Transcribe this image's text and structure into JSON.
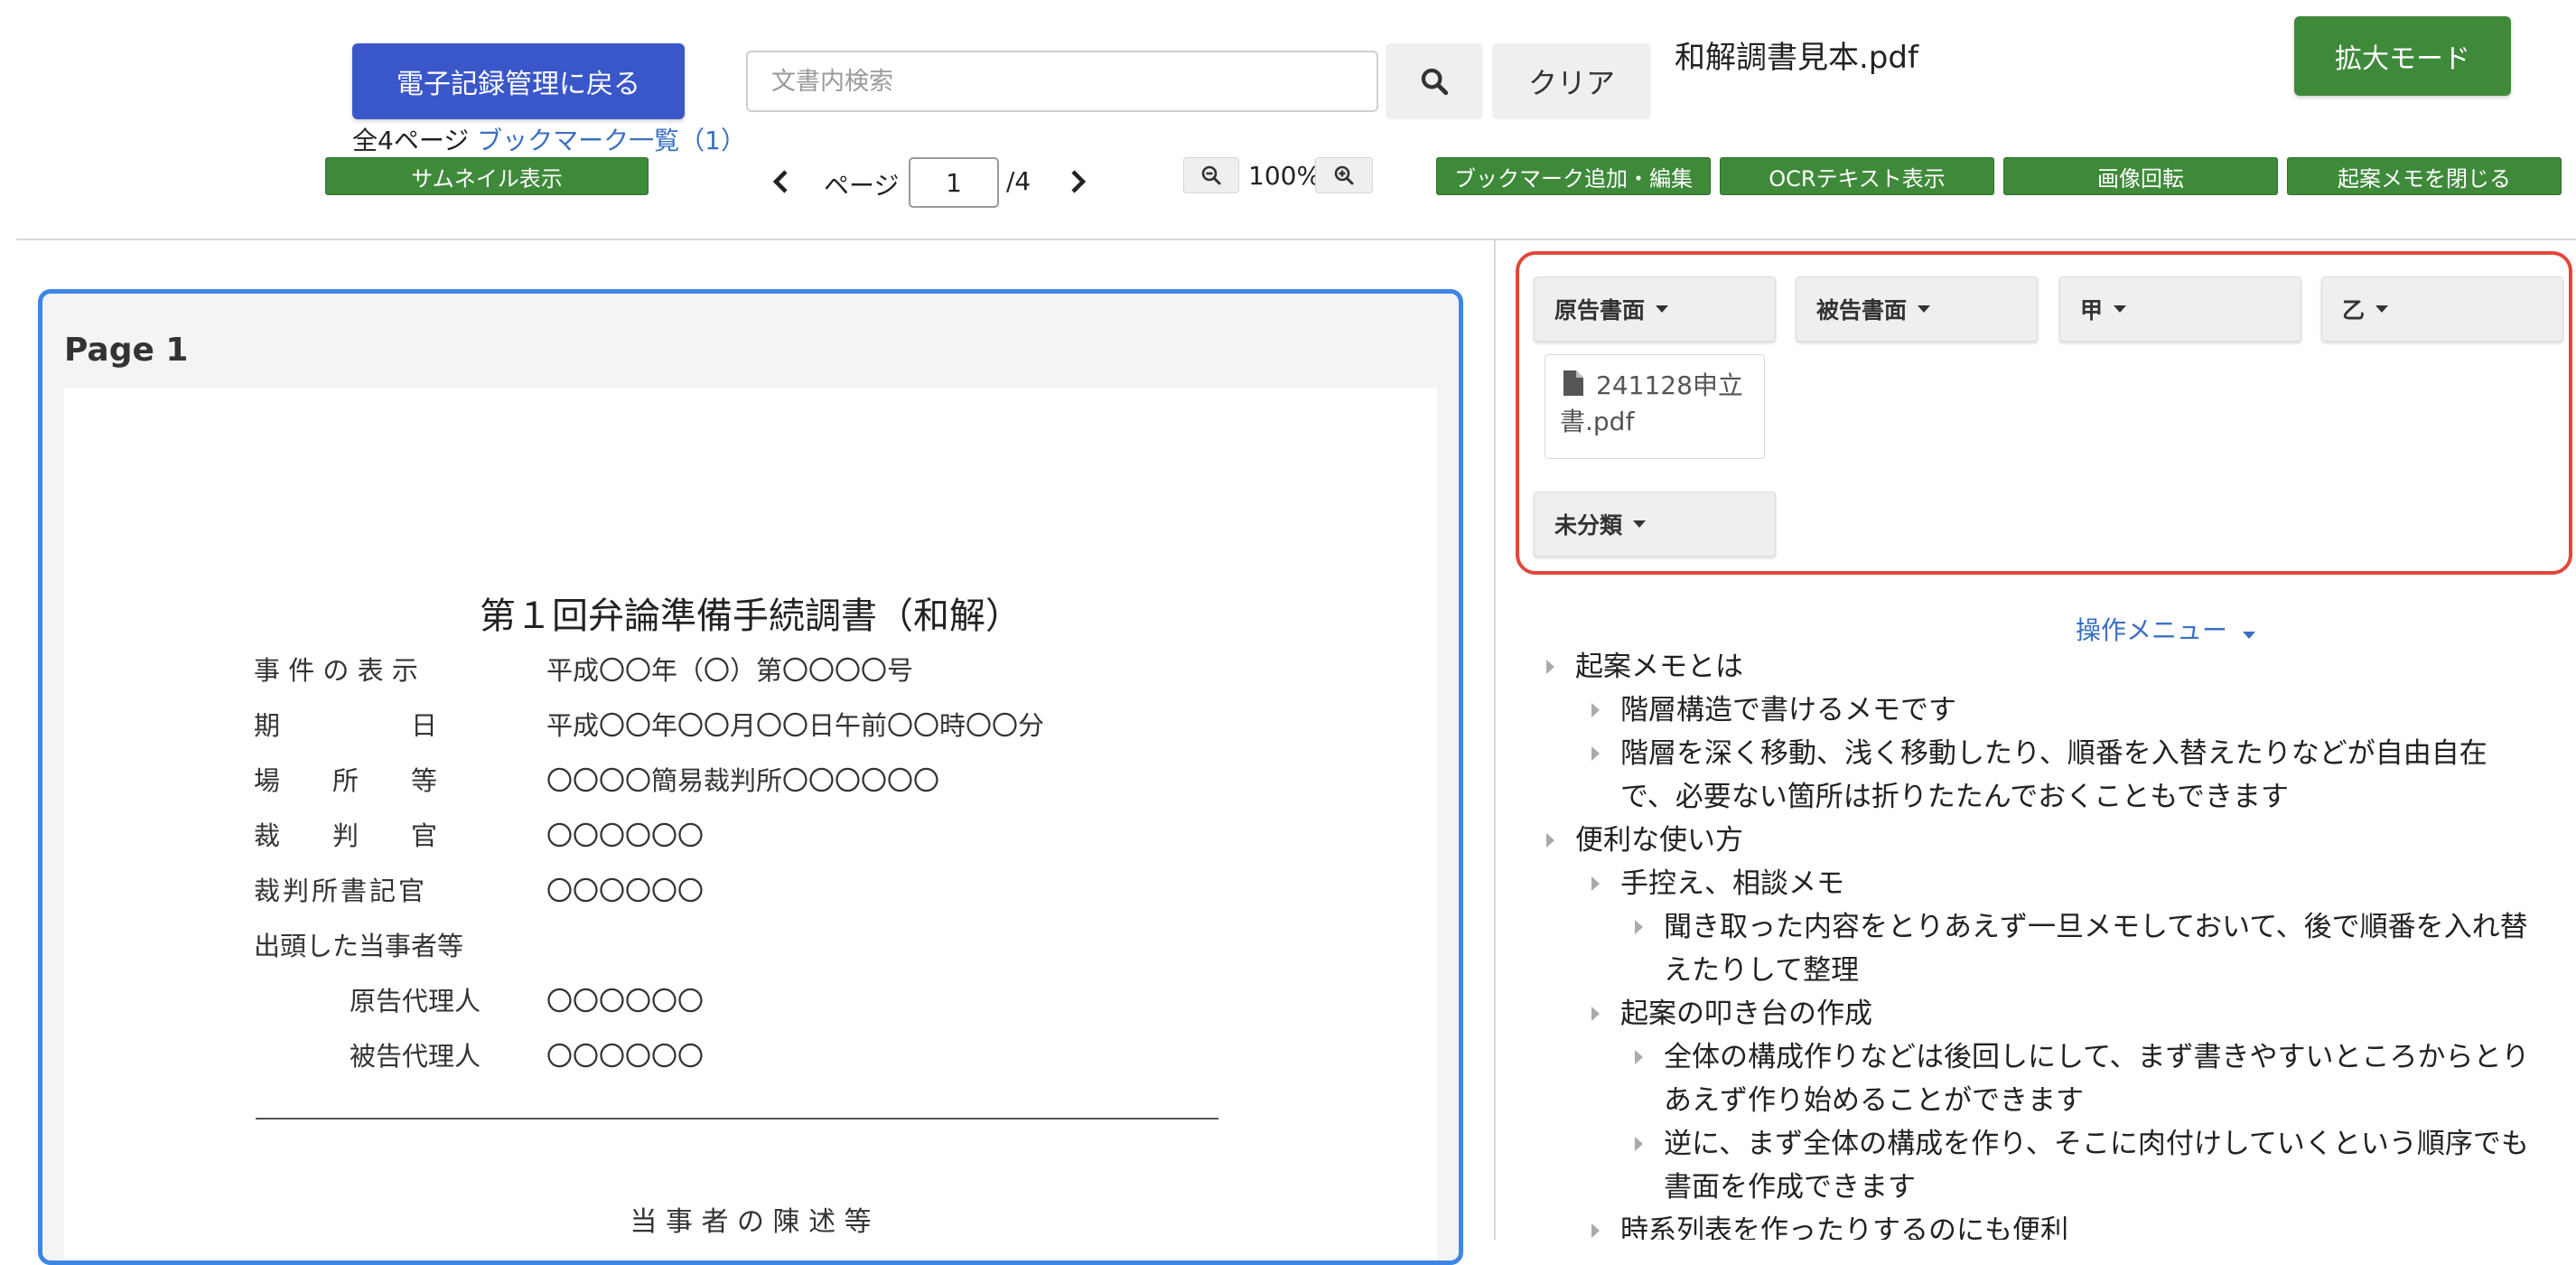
{
  "toolbar": {
    "back_label": "電子記録管理に戻る",
    "search_placeholder": "文書内検索",
    "clear_label": "クリア",
    "filename": "和解調書見本.pdf",
    "expand_label": "拡大モード",
    "page_total_text": "全4ページ",
    "bookmark_list_link": "ブックマーク一覧（1）",
    "thumbnail_label": "サムネイル表示",
    "page_label": "ページ",
    "page_value": "1",
    "page_of": "/4",
    "zoom_level": "100%",
    "bookmark_edit_label": "ブックマーク追加・編集",
    "ocr_label": "OCRテキスト表示",
    "rotate_label": "画像回転",
    "close_memo_label": "起案メモを閉じる"
  },
  "viewer": {
    "page_title": "Page 1",
    "doc_title": "第１回弁論準備手続調書（和解）",
    "rows": [
      {
        "label": "事 件 の 表 示",
        "value": "平成〇〇年（〇）第〇〇〇〇号"
      },
      {
        "label": "期　　　　　日",
        "value": "平成〇〇年〇〇月〇〇日午前〇〇時〇〇分"
      },
      {
        "label": "場　　所　　等",
        "value": "〇〇〇〇簡易裁判所〇〇〇〇〇〇"
      },
      {
        "label": "裁　　判　　官",
        "value": "〇〇〇〇〇〇"
      },
      {
        "label": "裁判所書記官",
        "value": "〇〇〇〇〇〇"
      },
      {
        "label": "出頭した当事者等",
        "value": ""
      },
      {
        "label": "原告代理人",
        "value": "〇〇〇〇〇〇"
      },
      {
        "label": "被告代理人",
        "value": "〇〇〇〇〇〇"
      }
    ],
    "section_heading": "当 事 者 の 陳 述 等"
  },
  "categories": {
    "plaintiff": "原告書面",
    "defendant": "被告書面",
    "ko": "甲",
    "otsu": "乙",
    "unclassified": "未分類",
    "file_name": "241128申立書.pdf"
  },
  "memo": {
    "menu_label": "操作メニュー",
    "items": [
      {
        "text": "起案メモとは"
      },
      {
        "text": "階層構造で書けるメモです"
      },
      {
        "text": "階層を深く移動、浅く移動したり、順番を入替えたりなどが自由自在",
        "text2": "で、必要ない箇所は折りたたんでおくこともできます"
      },
      {
        "text": "便利な使い方"
      },
      {
        "text": "手控え、相談メモ"
      },
      {
        "text": "聞き取った内容をとりあえず一旦メモしておいて、後で順番を入れ替",
        "text2": "えたりして整理"
      },
      {
        "text": "起案の叩き台の作成"
      },
      {
        "text": "全体の構成作りなどは後回しにして、まず書きやすいところからとり",
        "text2": "あえず作り始めることができます"
      },
      {
        "text": "逆に、まず全体の構成を作り、そこに肉付けしていくという順序でも",
        "text2": "書面を作成できます"
      },
      {
        "text": "時系列表を作ったりするのにも便利"
      }
    ]
  }
}
